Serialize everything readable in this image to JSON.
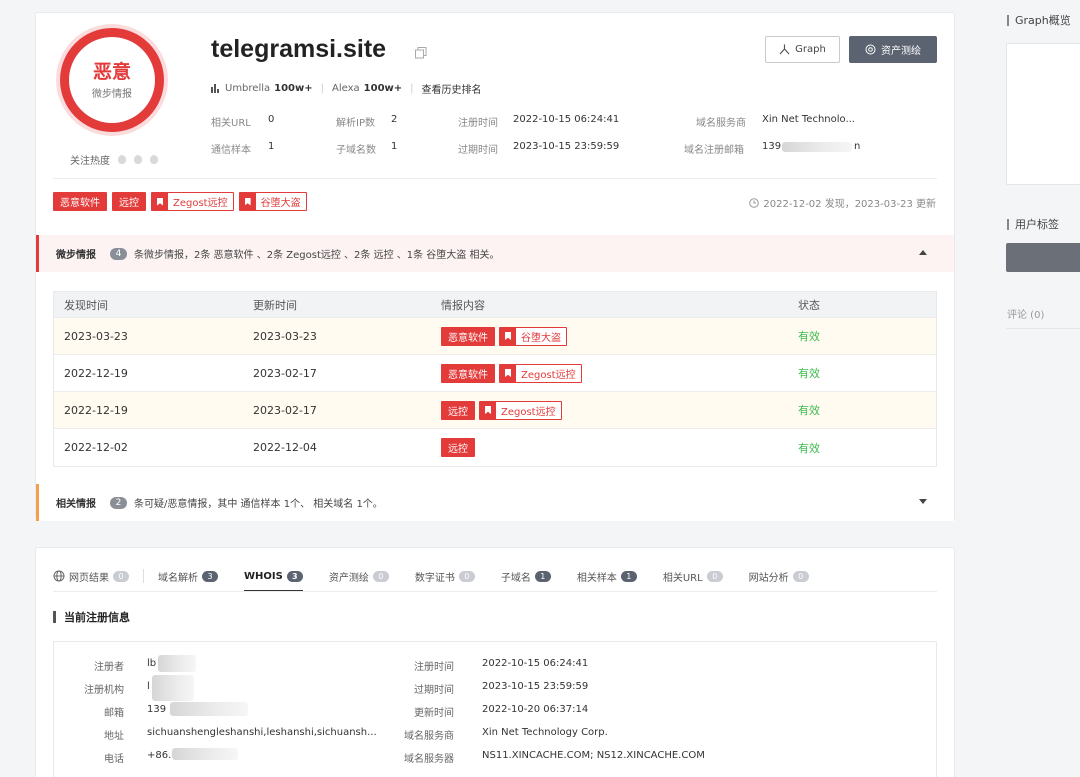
{
  "domain": "telegramsi.site",
  "threat": {
    "level": "恶意",
    "source": "微步情报",
    "heat_label": "关注热度"
  },
  "rank": {
    "umbrella_label": "Umbrella",
    "umbrella_value": "100w+",
    "alexa_label": "Alexa",
    "alexa_value": "100w+",
    "history_link": "查看历史排名"
  },
  "buttons": {
    "graph": "Graph",
    "asset": "资产测绘"
  },
  "info": {
    "url_label": "相关URL",
    "url_value": "0",
    "ip_label": "解析IP数",
    "ip_value": "2",
    "reg_time_label": "注册时间",
    "reg_time_value": "2022-10-15 06:24:41",
    "dns_label": "域名服务商",
    "dns_value": "Xin Net Technolo...",
    "sample_label": "通信样本",
    "sample_value": "1",
    "sub_label": "子域名数",
    "sub_value": "1",
    "exp_label": "过期时间",
    "exp_value": "2023-10-15 23:59:59",
    "email_label": "域名注册邮箱",
    "email_value_start": "139",
    "email_value_end": "n"
  },
  "tags": {
    "malware": "恶意软件",
    "remote": "远控",
    "zegost": "Zegost远控",
    "grain": "谷堕大盗"
  },
  "found_line": "2022-12-02 发现，2023-03-23 更新",
  "weibu": {
    "title": "微步情报",
    "count": "4",
    "desc": "条微步情报，2条 恶意软件 、2条 Zegost远控 、2条 远控 、1条 谷堕大盗 相关。"
  },
  "table": {
    "headers": [
      "发现时间",
      "更新时间",
      "情报内容",
      "状态"
    ],
    "rows": [
      {
        "found": "2023-03-23",
        "updated": "2023-03-23",
        "status": "有效"
      },
      {
        "found": "2022-12-19",
        "updated": "2023-02-17",
        "status": "有效"
      },
      {
        "found": "2022-12-19",
        "updated": "2023-02-17",
        "status": "有效"
      },
      {
        "found": "2022-12-02",
        "updated": "2022-12-04",
        "status": "有效"
      }
    ]
  },
  "related": {
    "title": "相关情报",
    "count": "2",
    "desc": "条可疑/恶意情报，其中 通信样本 1个、 相关域名 1个。"
  },
  "tabs": [
    {
      "label": "网页结果",
      "count": "0"
    },
    {
      "label": "域名解析",
      "count": "3"
    },
    {
      "label": "WHOIS",
      "count": "3"
    },
    {
      "label": "资产测绘",
      "count": "0"
    },
    {
      "label": "数字证书",
      "count": "0"
    },
    {
      "label": "子域名",
      "count": "1"
    },
    {
      "label": "相关样本",
      "count": "1"
    },
    {
      "label": "相关URL",
      "count": "0"
    },
    {
      "label": "网站分析",
      "count": "0"
    }
  ],
  "whois": {
    "title": "当前注册信息",
    "registrant_label": "注册者",
    "registrant_value": "lb",
    "org_label": "注册机构",
    "org_value": "l",
    "mail_label": "邮箱",
    "mail_value": "139",
    "addr_label": "地址",
    "addr_value": "sichuanshengleshanshi,leshanshi,sichuansh...",
    "phone_label": "电话",
    "phone_value": "+86.",
    "reg_label": "注册时间",
    "reg_value": "2022-10-15 06:24:41",
    "exp_label": "过期时间",
    "exp_value": "2023-10-15 23:59:59",
    "upd_label": "更新时间",
    "upd_value": "2022-10-20 06:37:14",
    "provider_label": "域名服务商",
    "provider_value": "Xin Net Technology Corp.",
    "ns_label": "域名服务器",
    "ns_value": "NS11.XINCACHE.COM; NS12.XINCACHE.COM"
  },
  "sidebar": {
    "graph_title": "Graph概览",
    "tags_title": "用户标签",
    "comments": "评论 (0)"
  },
  "colors": {
    "danger": "#e33a3a",
    "valid": "#3dbb4d",
    "dark_button": "#5b6270",
    "related_accent": "#f2a04c"
  }
}
